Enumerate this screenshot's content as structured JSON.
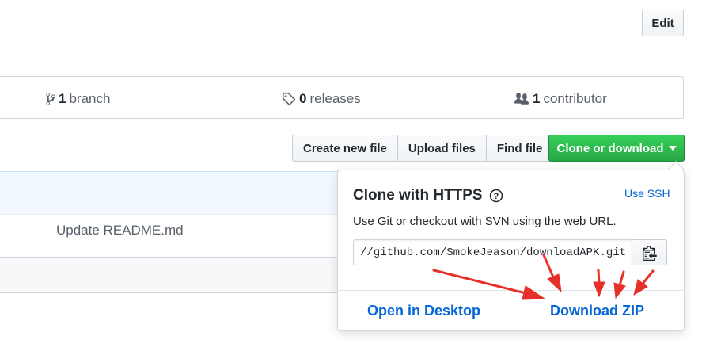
{
  "header": {
    "edit_label": "Edit"
  },
  "summary": {
    "branches": {
      "count": "1",
      "label": "branch",
      "icon": "branch-icon"
    },
    "releases": {
      "count": "0",
      "label": "releases",
      "icon": "tag-icon"
    },
    "contributors": {
      "count": "1",
      "label": "contributor",
      "icon": "people-icon"
    }
  },
  "toolbar": {
    "create_new_file": "Create new file",
    "upload_files": "Upload files",
    "find_file": "Find file",
    "clone_or_download": "Clone or download"
  },
  "file_list": {
    "commit_message": "Update README.md"
  },
  "clone_dropdown": {
    "title": "Clone with HTTPS",
    "use_ssh": "Use SSH",
    "description": "Use Git or checkout with SVN using the web URL.",
    "url": "//github.com/SmokeJeason/downloadAPK.git",
    "open_desktop": "Open in Desktop",
    "download_zip": "Download ZIP"
  },
  "colors": {
    "primary_green": "#28a745",
    "link_blue": "#0366d6",
    "annotation_red": "#e8302a"
  }
}
